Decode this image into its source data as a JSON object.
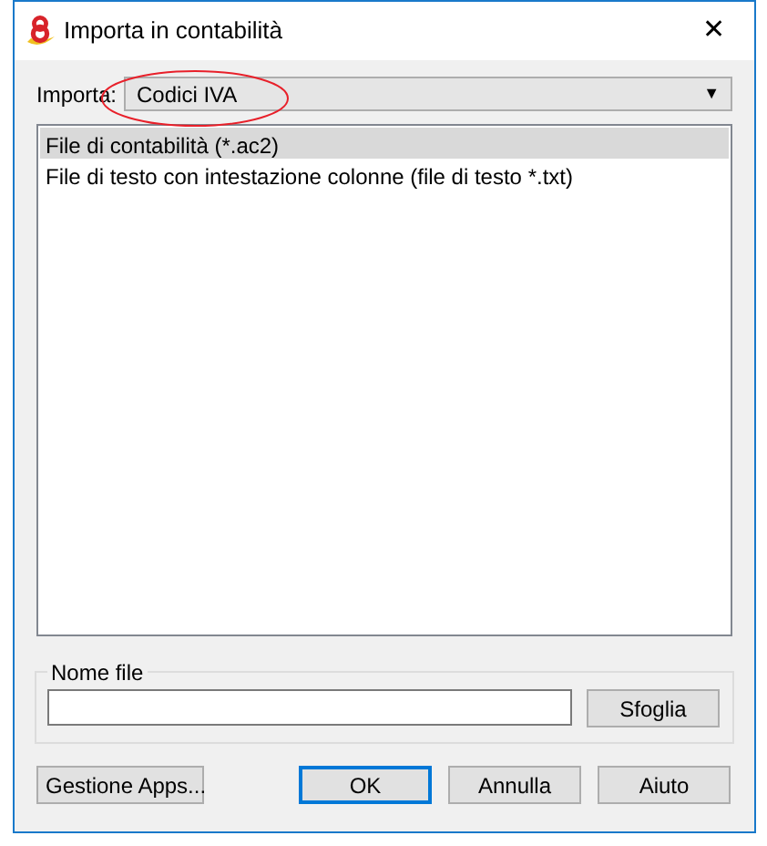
{
  "window": {
    "title": "Importa in contabilità",
    "close": "✕"
  },
  "import": {
    "label": "Importa:",
    "value": "Codici IVA",
    "arrow": "▼"
  },
  "files": [
    {
      "label": "File di contabilità (*.ac2)",
      "selected": true
    },
    {
      "label": "File di testo con intestazione colonne (file di testo *.txt)",
      "selected": false
    }
  ],
  "file_name": {
    "label": "Nome file",
    "browse": "Sfoglia"
  },
  "buttons": [
    {
      "label": "Gestione Apps...",
      "default": false,
      "kind": "left"
    },
    {
      "label": "OK",
      "default": true,
      "kind": "right"
    },
    {
      "label": "Annulla",
      "default": false,
      "kind": "right"
    },
    {
      "label": "Aiuto",
      "default": false,
      "kind": "right"
    }
  ]
}
